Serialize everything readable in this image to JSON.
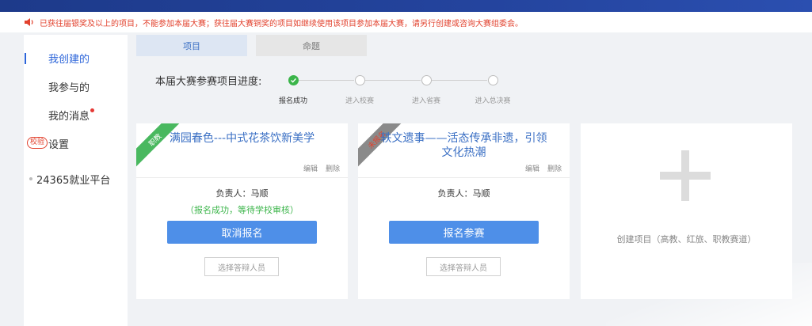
{
  "notice": {
    "icon": "speaker-icon",
    "text": "已获往届银奖及以上的项目，不能参加本届大赛；获往届大赛铜奖的项目如继续使用该项目参加本届大赛，请另行创建或咨询大赛组委会。",
    "color": "#e2412d"
  },
  "sidebar": {
    "items": [
      {
        "label": "我创建的",
        "active": true
      },
      {
        "label": "我参与的"
      },
      {
        "label": "我的消息",
        "has_dot": true
      },
      {
        "label": "设置",
        "badge": "校验"
      },
      {
        "label": "24365就业平台"
      }
    ],
    "accent": "#2b64d9"
  },
  "tabs": [
    {
      "label": "项目",
      "active": true
    },
    {
      "label": "命题"
    }
  ],
  "progress": {
    "label": "本届大赛参赛项目进度:",
    "steps": [
      {
        "label": "报名成功",
        "done": true
      },
      {
        "label": "进入校赛",
        "done": false
      },
      {
        "label": "进入省赛",
        "done": false
      },
      {
        "label": "进入总决赛",
        "done": false
      }
    ]
  },
  "cards": [
    {
      "ribbon": "职教",
      "title": "满园春色---中式花茶饮新美学",
      "edit": "编辑",
      "delete": "删除",
      "owner": "负责人：马顺",
      "status": "（报名成功，等待学校审核）",
      "primary": "取消报名",
      "secondary": "选择答辩人员"
    },
    {
      "ribbon": "未报名",
      "title": "轶文遗事——活态传承非遗，引领文化热潮",
      "edit": "编辑",
      "delete": "删除",
      "owner": "负责人：马顺",
      "primary": "报名参赛",
      "secondary": "选择答辩人员"
    }
  ],
  "create": {
    "icon": "plus-icon",
    "label": "创建项目（高教、红旅、职教赛道）"
  }
}
